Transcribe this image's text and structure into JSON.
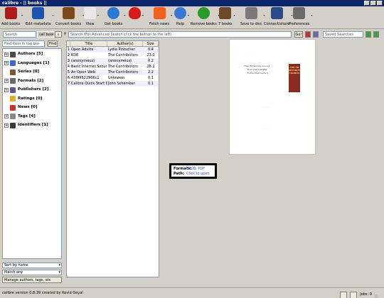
{
  "window": {
    "title": "calibre - || books ||"
  },
  "toolbar": {
    "items": [
      {
        "label": "Add books",
        "icon": "add-books-icon",
        "color": "#b01818"
      },
      {
        "label": "Edit metadata",
        "icon": "info-icon",
        "color": "#1c54b4"
      },
      {
        "label": "Convert books",
        "icon": "convert-icon",
        "color": "#7a4a1a"
      },
      {
        "label": "View",
        "icon": "magnifier-icon",
        "color": "#e8e8e8"
      },
      {
        "label": "Get books",
        "icon": "globe-icon",
        "color": "#2a7ad8"
      },
      {
        "label": "",
        "icon": "heart-icon",
        "color": "#d61a1a"
      },
      {
        "label": "Fetch news",
        "icon": "news-icon",
        "color": "#f06020"
      },
      {
        "label": "Help",
        "icon": "help-icon",
        "color": "#3a78d8"
      },
      {
        "label": "Remove books",
        "icon": "recycle-icon",
        "color": "#2a9a2a"
      },
      {
        "label": "7 books",
        "icon": "library-icon",
        "color": "#6a4a2a"
      },
      {
        "label": "Save to disc",
        "icon": "save-icon",
        "color": "#7a7a7a"
      },
      {
        "label": "Connect/share",
        "icon": "connect-icon",
        "color": "#2a4a8a"
      },
      {
        "label": "Preferences",
        "icon": "preferences-icon",
        "color": "#6a6a6a"
      }
    ]
  },
  "controls": {
    "virtual_library": "Search",
    "all_books": "(all books)",
    "search_placeholder": "Search (For Advanced Search click the button to the left)",
    "go_label": "Go!",
    "saved_searches": "Saved Searches"
  },
  "tagbrowser": {
    "find_placeholder": "Find item in tag bro",
    "find_label": "Find",
    "items": [
      {
        "label": "Authors [5]",
        "expander": "+",
        "color": "#4a4a4a"
      },
      {
        "label": "Languages [1]",
        "expander": "+",
        "color": "#3a6ad0"
      },
      {
        "label": "Series [0]",
        "expander": "",
        "color": "#7a5a3a"
      },
      {
        "label": "Formats [2]",
        "expander": "+",
        "color": "#6a6a6a"
      },
      {
        "label": "Publishers [2]",
        "expander": "+",
        "color": "#5a5a8a"
      },
      {
        "label": "Ratings [0]",
        "expander": "",
        "color": "#e0b020"
      },
      {
        "label": "News [0]",
        "expander": "",
        "color": "#d03030"
      },
      {
        "label": "Tags [4]",
        "expander": "+",
        "color": "#8a8a8a"
      },
      {
        "label": "Identifiers [1]",
        "expander": "+",
        "color": "#3a3a3a"
      }
    ],
    "sort_by": "Sort by name",
    "match": "Match any",
    "manage": "Manage authors, tags, etc"
  },
  "booklist": {
    "headers": [
      "Title",
      "Author(s)",
      "Size (MB)"
    ],
    "rows": [
      {
        "num": "1",
        "title": "Open Advice",
        "author": "Lydia Pintscher",
        "size": "0.4"
      },
      {
        "num": "2",
        "title": "KDE",
        "author": "The Contributors",
        "size": "23.0"
      },
      {
        "num": "3",
        "title": "(anonymous)",
        "author": "(anonymous)",
        "size": "0.2"
      },
      {
        "num": "4",
        "title": "Basic Internet Security",
        "author": "The Contributors",
        "size": "28.2"
      },
      {
        "num": "5",
        "title": "An Open Web",
        "author": "The Contributors",
        "size": "2.2"
      },
      {
        "num": "6",
        "title": "43f99522966c1",
        "author": "Unknown",
        "size": "0.1"
      },
      {
        "num": "7",
        "title": "Calibre Quick Start Guide",
        "author": "John Schember",
        "size": "0.1"
      }
    ]
  },
  "details": {
    "formats_key": "Formats:",
    "formats_val": "EPUB, PDF",
    "path_key": "Path:",
    "path_val": "Click to open"
  },
  "cover": {
    "heading": "The UN Security Council",
    "sub1": "From the Cold War",
    "sub2": "to the 21st Century",
    "book_title": "THE UN SECURITY COUNCIL"
  },
  "status": {
    "version": "calibre version 0.8.39 created by Kovid Goyal",
    "jobs": "Jobs: 0"
  }
}
